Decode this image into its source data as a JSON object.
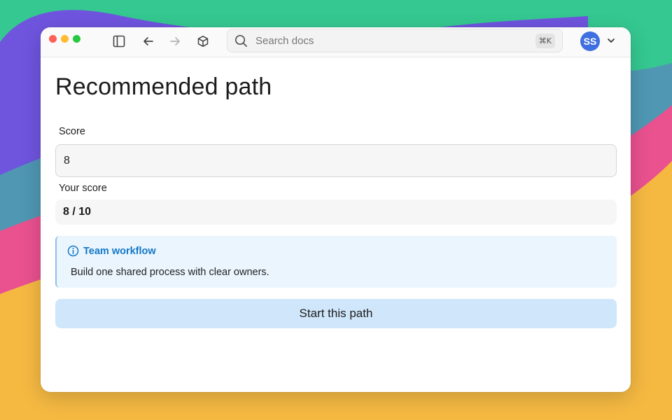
{
  "window": {
    "controls": [
      "close",
      "minimize",
      "zoom"
    ]
  },
  "toolbar": {
    "icons": [
      "sidebar-toggle-icon",
      "back-arrow-icon",
      "forward-arrow-icon",
      "cube-icon"
    ],
    "search": {
      "placeholder": "Search docs",
      "shortcut": "⌘K"
    },
    "avatar": {
      "initials": "SS",
      "color": "#3f6fe0"
    }
  },
  "main": {
    "title": "Recommended path",
    "score_field": {
      "label": "Score",
      "value": "8"
    },
    "your_score": {
      "label": "Your score",
      "value": "8 / 10"
    },
    "callout": {
      "title": "Team workflow",
      "body": "Build one shared process with clear owners.",
      "accent": "#1478c8"
    },
    "start_button": {
      "label": "Start this path",
      "color": "#cfe6fb"
    }
  }
}
